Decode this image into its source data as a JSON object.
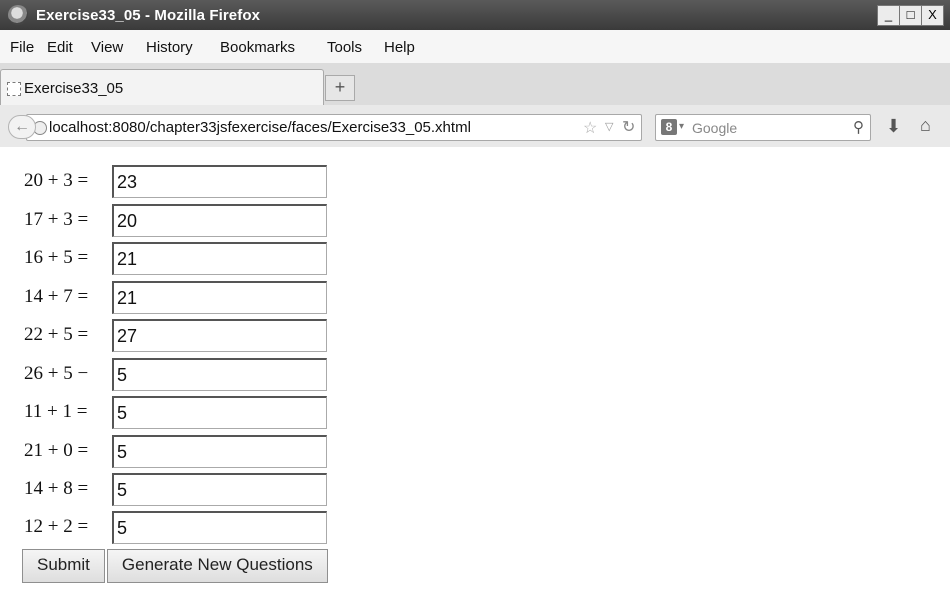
{
  "window": {
    "title": "Exercise33_05 - Mozilla Firefox",
    "controls": [
      "_",
      "□",
      "X"
    ]
  },
  "menu": [
    "File",
    "Edit",
    "View",
    "History",
    "Bookmarks",
    "Tools",
    "Help"
  ],
  "tab": {
    "label": "Exercise33_05",
    "new_tab": "+"
  },
  "nav": {
    "url": "localhost:8080/chapter33jsfexercise/faces/Exercise33_05.xhtml",
    "search_engine": "8",
    "search_placeholder": "Google"
  },
  "questions": [
    {
      "text": "20 + 3 =",
      "answer": "23"
    },
    {
      "text": "17 + 3 =",
      "answer": "20"
    },
    {
      "text": "16 + 5 =",
      "answer": "21"
    },
    {
      "text": "14 + 7 =",
      "answer": "21"
    },
    {
      "text": "22 + 5 =",
      "answer": "27"
    },
    {
      "text": "26 + 5 −",
      "answer": "5"
    },
    {
      "text": "11 + 1 =",
      "answer": "5"
    },
    {
      "text": "21 + 0 =",
      "answer": "5"
    },
    {
      "text": "14 + 8 =",
      "answer": "5"
    },
    {
      "text": "12 + 2 =",
      "answer": "5"
    }
  ],
  "buttons": {
    "submit": "Submit",
    "generate": "Generate New Questions"
  }
}
